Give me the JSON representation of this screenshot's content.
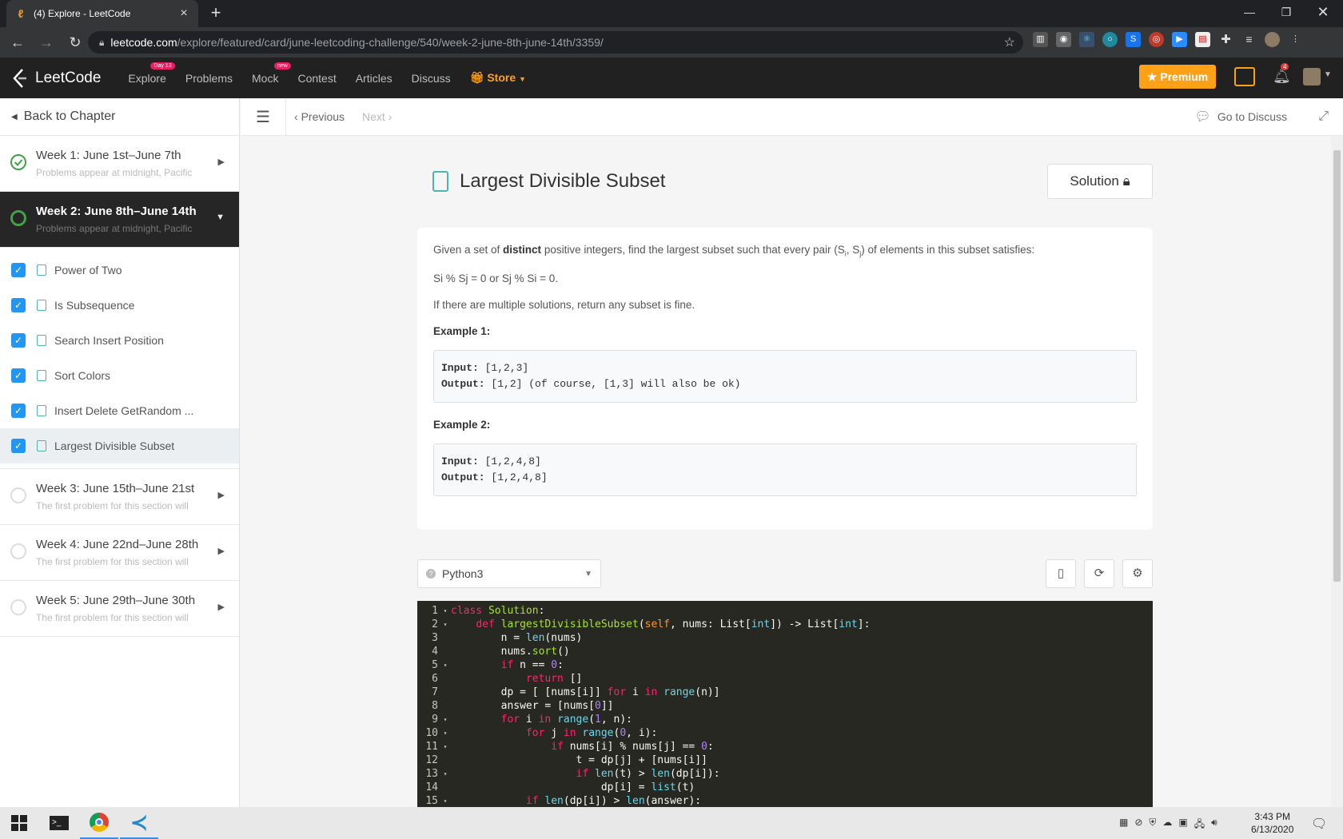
{
  "browser": {
    "tab_title": "(4) Explore - LeetCode",
    "url_host": "leetcode.com",
    "url_path": "/explore/featured/card/june-leetcoding-challenge/540/week-2-june-8th-june-14th/3359/"
  },
  "navbar": {
    "logo": "LeetCode",
    "explore": "Explore",
    "explore_badge": "Day 13",
    "problems": "Problems",
    "mock": "Mock",
    "mock_badge": "new",
    "contest": "Contest",
    "articles": "Articles",
    "discuss": "Discuss",
    "store": "Store",
    "premium": "Premium",
    "notifications": "4"
  },
  "sidebar": {
    "back": "Back to Chapter",
    "weeks": [
      {
        "title": "Week 1: June 1st–June 7th",
        "subtitle": "Problems appear at midnight, Pacific",
        "status": "done"
      },
      {
        "title": "Week 2: June 8th–June 14th",
        "subtitle": "Problems appear at midnight, Pacific",
        "status": "partial"
      },
      {
        "title": "Week 3: June 15th–June 21st",
        "subtitle": "The first problem for this section will",
        "status": "none"
      },
      {
        "title": "Week 4: June 22nd–June 28th",
        "subtitle": "The first problem for this section will",
        "status": "none"
      },
      {
        "title": "Week 5: June 29th–June 30th",
        "subtitle": "The first problem for this section will",
        "status": "none"
      }
    ],
    "lessons": [
      "Power of Two",
      "Is Subsequence",
      "Search Insert Position",
      "Sort Colors",
      "Insert Delete GetRandom ...",
      "Largest Divisible Subset"
    ]
  },
  "toolbar": {
    "previous": "Previous",
    "next": "Next",
    "go_to_discuss": "Go to Discuss"
  },
  "problem": {
    "title": "Largest Divisible Subset",
    "solution_button": "Solution",
    "desc_part1": "Given a set of ",
    "desc_bold": "distinct",
    "desc_part2": " positive integers, find the largest subset such that every pair (S",
    "desc_part3": ", S",
    "desc_part4": ") of elements in this subset satisfies:",
    "condition": "Si % Sj = 0 or Sj % Si = 0.",
    "note": "If there are multiple solutions, return any subset is fine.",
    "example1_label": "Example 1:",
    "example1_input": "[1,2,3]",
    "example1_output": "[1,2] (of course, [1,3] will also be ok)",
    "example2_label": "Example 2:",
    "example2_input": "[1,2,4,8]",
    "example2_output": "[1,2,4,8]",
    "input_label": "Input:",
    "output_label": "Output:"
  },
  "editor": {
    "language": "Python3"
  },
  "taskbar": {
    "time": "3:43 PM",
    "date": "6/13/2020"
  },
  "colors": {
    "accent": "#ffa116",
    "check": "#2196f3",
    "editor_bg": "#272822"
  }
}
